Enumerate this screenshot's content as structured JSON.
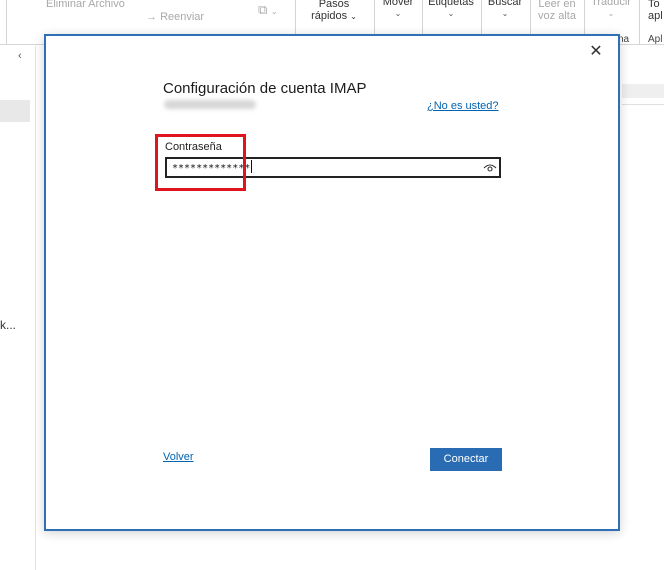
{
  "ribbon": {
    "delete_archive": "Eliminar Archivo",
    "forward": "Reenviar",
    "quick_steps_line1": "Pasos",
    "quick_steps_line2": "rápidos",
    "move": "Mover",
    "tags": "Etiquetas",
    "search": "Buscar",
    "read_aloud_line1": "Leer en",
    "read_aloud_line2": "voz alta",
    "translate": "Traducir",
    "group_label_ma": "na",
    "apps_line1": "To",
    "apps_line2": "apl",
    "group_label_apps": "Apl"
  },
  "left_pane": {
    "truncated_text": "k..."
  },
  "dialog": {
    "title": "Configuración de cuenta IMAP",
    "not_you_link": "¿No es usted?",
    "password_label": "Contraseña",
    "password_value": "*************",
    "back_link": "Volver",
    "connect_button": "Conectar"
  }
}
